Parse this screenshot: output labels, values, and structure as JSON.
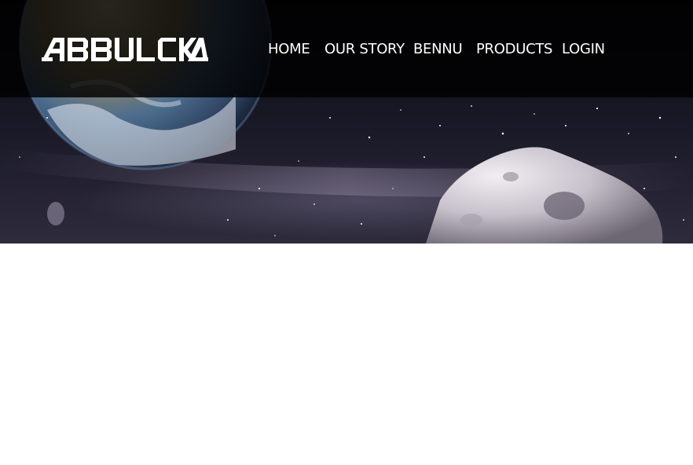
{
  "brand": {
    "logo_text": "ABBULCKA",
    "logo_icon": "abbulcka-wordmark"
  },
  "nav": {
    "items": [
      {
        "label": "HOME"
      },
      {
        "label": "OUR STORY"
      },
      {
        "label": "BENNU"
      },
      {
        "label": "PRODUCTS"
      },
      {
        "label": "LOGIN"
      }
    ]
  },
  "hero": {
    "image": "earth-and-asteroid-space-scene"
  },
  "colors": {
    "nav_text": "#ffffff",
    "header_overlay": "#000000",
    "page_background": "#ffffff"
  }
}
